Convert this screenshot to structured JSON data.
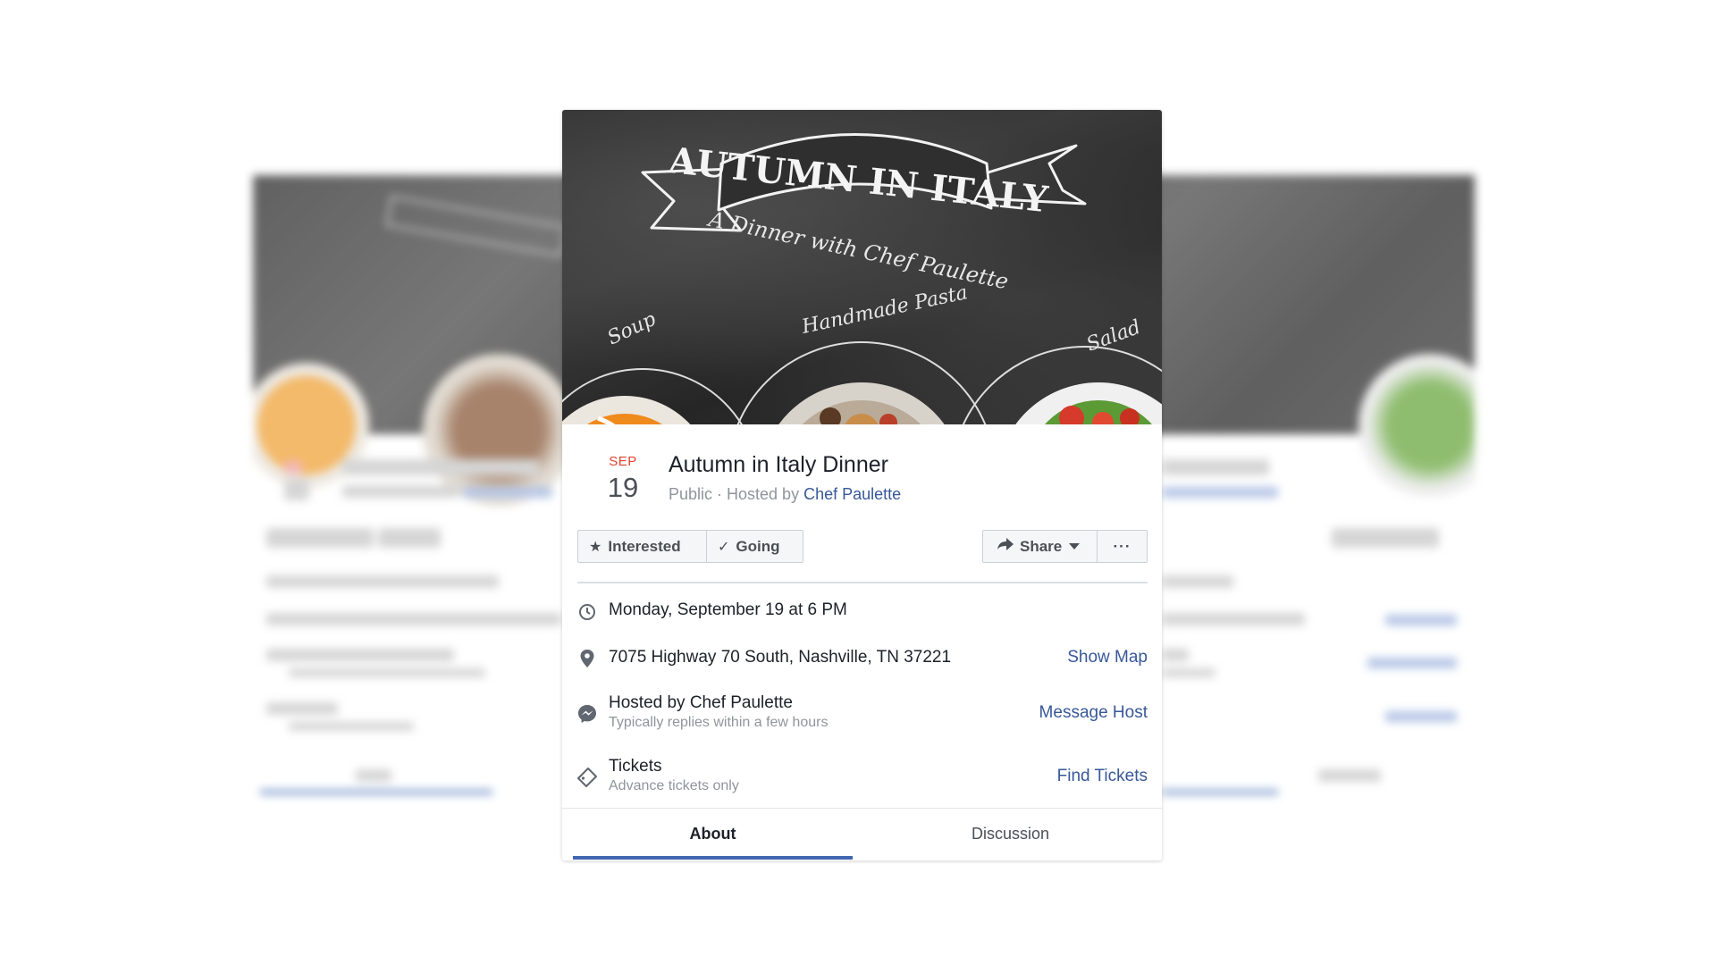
{
  "cover": {
    "banner_text": "AUTUMN IN ITALY",
    "script_text": "A Dinner with Chef Paulette",
    "labels": [
      "Soup",
      "Handmade Pasta",
      "Salad"
    ]
  },
  "event": {
    "month": "SEP",
    "day": "19",
    "title": "Autumn in Italy Dinner",
    "privacy": "Public",
    "hosted_by_prefix": " · Hosted by ",
    "host_name": "Chef Paulette"
  },
  "buttons": {
    "interested": "Interested",
    "going": "Going",
    "share": "Share",
    "more": "···"
  },
  "details": {
    "datetime": "Monday, September 19 at 6 PM",
    "address": "7075 Highway 70 South, Nashville, TN 37221",
    "show_map": "Show Map",
    "host_line": "Hosted by Chef Paulette",
    "host_reply": "Typically replies within a few hours",
    "message_host": "Message Host",
    "tickets": "Tickets",
    "tickets_note": "Advance tickets only",
    "find_tickets": "Find Tickets"
  },
  "tabs": [
    "About",
    "Discussion"
  ],
  "colors": {
    "accent": "#4267b2",
    "link": "#385898",
    "date_month": "#e0422e"
  }
}
